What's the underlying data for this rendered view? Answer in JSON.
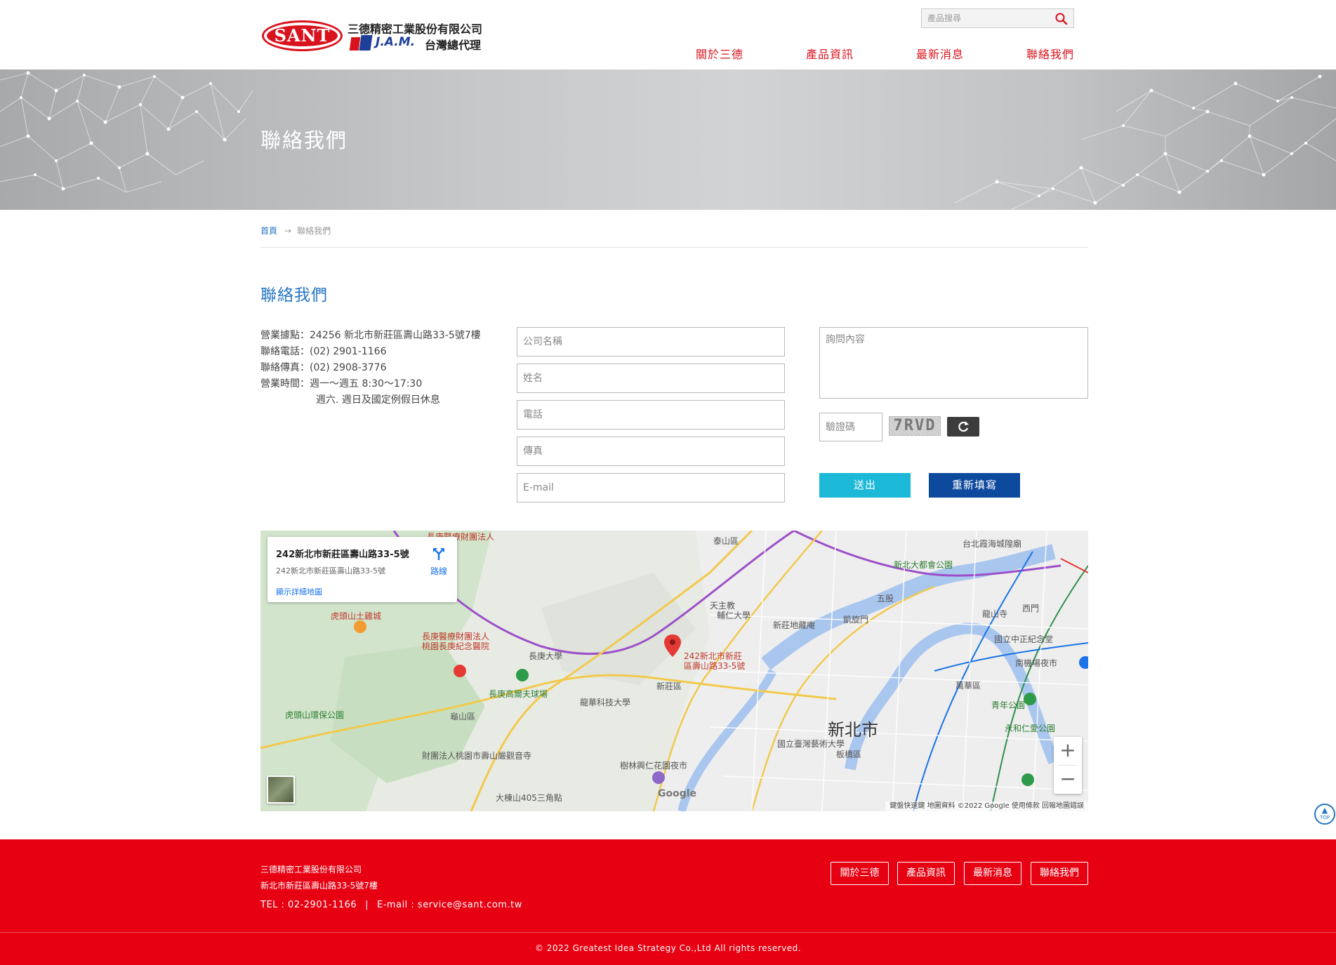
{
  "header": {
    "logo_mark": "SANT",
    "logo_company": "三德精密工業股份有限公司",
    "logo_brand": "J.A.M.",
    "logo_agent": "台灣總代理",
    "search_placeholder": "產品搜尋",
    "nav": [
      {
        "label": "關於三德"
      },
      {
        "label": "產品資訊"
      },
      {
        "label": "最新消息"
      },
      {
        "label": "聯絡我們"
      }
    ]
  },
  "banner": {
    "title": "聯絡我們"
  },
  "breadcrumb": {
    "home": "首頁",
    "current": "聯絡我們"
  },
  "section_title": "聯絡我們",
  "contact": {
    "address": "營業據點：24256 新北市新莊區壽山路33-5號7樓",
    "phone": "聯絡電話：(02) 2901-1166",
    "fax": "聯絡傳真：(02) 2908-3776",
    "hours": "營業時間：週一～週五 8:30～17:30",
    "hours_note": "週六. 週日及國定例假日休息"
  },
  "form": {
    "company_placeholder": "公司名稱",
    "name_placeholder": "姓名",
    "phone_placeholder": "電話",
    "fax_placeholder": "傳真",
    "email_placeholder": "E-mail",
    "message_placeholder": "詢問內容",
    "captcha_placeholder": "驗證碼",
    "captcha_code": "7RVD",
    "submit_label": "送出",
    "reset_label": "重新填寫"
  },
  "map": {
    "card_title": "242新北市新莊區壽山路33-5號",
    "card_subtitle": "242新北市新莊區壽山路33-5號",
    "card_link": "顯示詳細地圖",
    "directions_label": "路線",
    "pin_label_1": "242新北市新莊",
    "pin_label_2": "區壽山路33-5號",
    "google": "Google",
    "footer_text": "鍵盤快速鍵  地圖資料 ©2022 Google  使用條款  回報地圖錯誤",
    "zoom_in": "+",
    "zoom_out": "−",
    "labels": {
      "taishan": "泰山區",
      "xinbei": "新北市",
      "xinzhuang": "新莊區",
      "guishan": "龜山區",
      "banqiao": "板橋區",
      "wanhua": "萬華區",
      "hospital1": "長庚醫療財團法人",
      "hospital1b": "桃園長庚紀念醫院",
      "changgung": "長庚大學",
      "golf": "長庚高爾夫球場",
      "huutoushan": "虎頭山土雞城",
      "fujen": "天主教",
      "fujen2": "輔仁大學",
      "minghua": "龍華科技大學",
      "shilin": "樹林興仁花園夜市",
      "tree405": "大棟山405三角點",
      "taipeiBridge": "新北大都會公園",
      "zhongzheng": "國立中正紀念堂",
      "qingnian": "青年公園",
      "yonghe": "永和仁愛公園",
      "nanjichang": "南機場夜市",
      "ncaf": "國立臺灣藝術大學",
      "wugu": "五股",
      "xinzhuang_hospital": "新莊地藏庵",
      "kaixuan": "凱旋門",
      "longshan": "龍山寺",
      "ximen": "西門",
      "hongye": "虎頭山環保公園",
      "taipei_sea": "台北霞海城隍廟",
      "shoushan": "財團法人桃園市壽山嚴觀音寺"
    }
  },
  "footer": {
    "company": "三德精密工業股份有限公司",
    "address": "新北市新莊區壽山路33-5號7樓",
    "tel": "TEL : 02-2901-1166",
    "email": "E-mail : service@sant.com.tw",
    "links": [
      {
        "label": "關於三德"
      },
      {
        "label": "產品資訊"
      },
      {
        "label": "最新消息"
      },
      {
        "label": "聯絡我們"
      }
    ],
    "copyright": "© 2022 Greatest Idea Strategy Co.,Ltd All rights reserved."
  },
  "top_button": "TOP",
  "colors": {
    "brand_red": "#e60012",
    "link_blue": "#2676c1",
    "submit_cyan": "#1cb8d8",
    "reset_navy": "#0d4a9d"
  }
}
